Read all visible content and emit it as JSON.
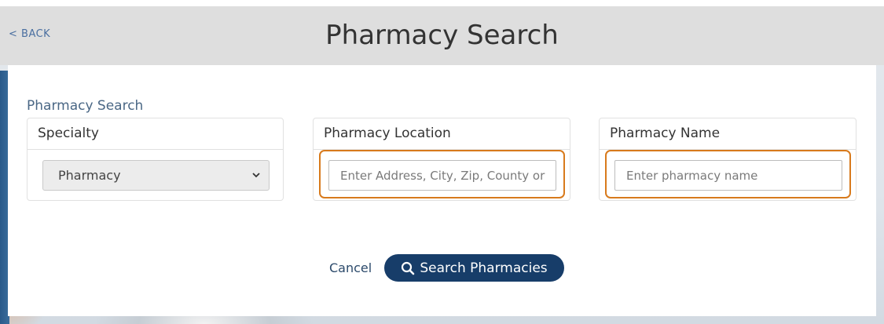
{
  "header": {
    "back_label": "< BACK",
    "title": "Pharmacy Search"
  },
  "form": {
    "section_label": "Pharmacy Search",
    "specialty": {
      "title": "Specialty",
      "selected": "Pharmacy"
    },
    "location": {
      "title": "Pharmacy Location",
      "placeholder": "Enter Address, City, Zip, County or"
    },
    "name": {
      "title": "Pharmacy Name",
      "placeholder": "Enter pharmacy name"
    }
  },
  "actions": {
    "cancel_label": "Cancel",
    "search_label": "Search Pharmacies"
  },
  "colors": {
    "header_bg": "#dedede",
    "accent_focus": "#d87a1c",
    "button_bg": "#173d69",
    "link": "#4a6fa0"
  },
  "icons": {
    "search": "search-icon",
    "select_chevron": "chevron-down-icon"
  }
}
